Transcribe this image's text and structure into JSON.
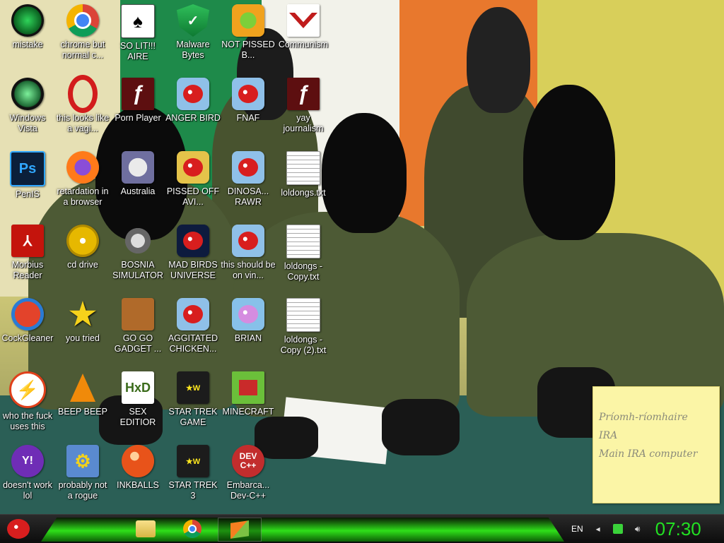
{
  "desktop": {
    "icons": [
      {
        "label": "mistake",
        "icon": "round-green-icon"
      },
      {
        "label": "chrome but normal c...",
        "icon": "chrome-icon"
      },
      {
        "label": "SO LIT!!! AIRE",
        "icon": "solitaire-icon"
      },
      {
        "label": "Malware Bytes",
        "icon": "shield-icon"
      },
      {
        "label": "NOT PISSED B...",
        "icon": "pig-icon"
      },
      {
        "label": "Communism",
        "icon": "communism-icon"
      },
      {
        "label": "Windows Vista",
        "icon": "vista-icon"
      },
      {
        "label": "this looks like a vagi...",
        "icon": "opera-icon"
      },
      {
        "label": "Porn Player",
        "icon": "flash-icon"
      },
      {
        "label": "ANGER BIRD",
        "icon": "angry-bird-icon"
      },
      {
        "label": "FNAF",
        "icon": "angry-bird-icon"
      },
      {
        "label": "yay journalism",
        "icon": "flash-icon"
      },
      {
        "label": "PenIS",
        "icon": "photoshop-icon"
      },
      {
        "label": "retardation in a browser",
        "icon": "firefox-icon"
      },
      {
        "label": "Australia",
        "icon": "spider-solitaire-icon"
      },
      {
        "label": "PISSED OFF AVI...",
        "icon": "angry-birds-seasons-icon"
      },
      {
        "label": "DINOSA... RAWR",
        "icon": "angry-bird-icon"
      },
      {
        "label": "loldongs.txt",
        "icon": "text-file-icon"
      },
      {
        "label": "Morbius Reader",
        "icon": "pdf-icon"
      },
      {
        "label": "cd drive",
        "icon": "cd-icon"
      },
      {
        "label": "BOSNIA SIMULATOR",
        "icon": "mine-icon"
      },
      {
        "label": "MAD BIRDS UNIVERSE",
        "icon": "angry-birds-space-icon"
      },
      {
        "label": "this should be on vin...",
        "icon": "angry-bird-icon"
      },
      {
        "label": "loldongs - Copy.txt",
        "icon": "text-file-icon"
      },
      {
        "label": "CockGleaner",
        "icon": "ccleaner-icon"
      },
      {
        "label": "you tried",
        "icon": "star-icon"
      },
      {
        "label": "GO GO GADGET ...",
        "icon": "briefcase-icon"
      },
      {
        "label": "AGGITATED CHICKEN...",
        "icon": "angry-bird-icon"
      },
      {
        "label": "BRIAN",
        "icon": "angry-bird-purple-icon"
      },
      {
        "label": "loldongs - Copy (2).txt",
        "icon": "text-file-icon"
      },
      {
        "label": "who the fuck uses this",
        "icon": "zap-icon"
      },
      {
        "label": "BEEP BEEP",
        "icon": "vlc-cone-icon"
      },
      {
        "label": "SEX EDITIOR",
        "icon": "hxd-icon"
      },
      {
        "label": "STAR TREK GAME",
        "icon": "angry-birds-star-wars-icon"
      },
      {
        "label": "MINECRAFT",
        "icon": "minecraft-icon"
      },
      {
        "label": "doesn't work lol",
        "icon": "yahoo-icon"
      },
      {
        "label": "probably not a rogue",
        "icon": "gears-icon"
      },
      {
        "label": "INKBALLS",
        "icon": "inkball-icon"
      },
      {
        "label": "STAR TREK 3",
        "icon": "angry-birds-star-wars-icon"
      },
      {
        "label": "Embarca... Dev-C++",
        "icon": "dev-cpp-icon"
      }
    ]
  },
  "sticky_note": {
    "lines": [
      "Príomh-ríomhaire",
      "IRA",
      "Main IRA computer"
    ]
  },
  "taskbar": {
    "start_icon": "angry-bird-icon",
    "pinned": [
      {
        "name": "explorer-folder-icon"
      },
      {
        "name": "chrome-icon"
      },
      {
        "name": "windows-flag-icon"
      }
    ],
    "tray": {
      "language": "EN",
      "icons": [
        "back-arrow-icon",
        "battery-icon",
        "volume-icon"
      ],
      "clock": "07:30"
    }
  },
  "colors": {
    "taskbar_glow": "#2ee019",
    "clock": "#22e022",
    "sticky": "#fbf5a6"
  }
}
